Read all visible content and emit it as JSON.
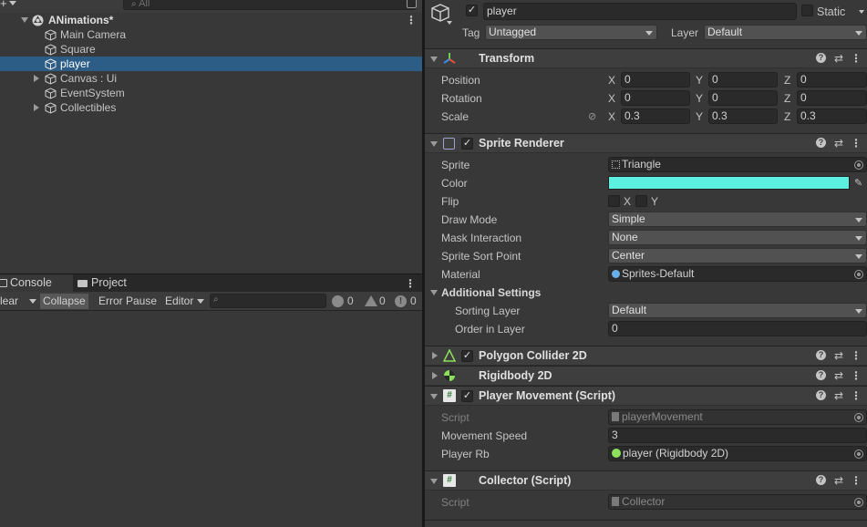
{
  "hierarchy": {
    "search_placeholder": "All",
    "scene_name": "ANimations*",
    "items": [
      {
        "label": "Main Camera",
        "expandable": false,
        "selected": false
      },
      {
        "label": "Square",
        "expandable": false,
        "selected": false
      },
      {
        "label": "player",
        "expandable": false,
        "selected": true
      },
      {
        "label": "Canvas : Ui",
        "expandable": true,
        "selected": false
      },
      {
        "label": "EventSystem",
        "expandable": false,
        "selected": false
      },
      {
        "label": "Collectibles",
        "expandable": true,
        "selected": false
      }
    ]
  },
  "console": {
    "tab_console": "Console",
    "tab_project": "Project",
    "clear_label": "lear",
    "collapse_label": "Collapse",
    "error_pause_label": "Error Pause",
    "editor_label": "Editor",
    "log_count": "0",
    "warn_count": "0",
    "error_count": "0"
  },
  "inspector": {
    "object_name": "player",
    "static_label": "Static",
    "tag_label": "Tag",
    "tag_value": "Untagged",
    "layer_label": "Layer",
    "layer_value": "Default",
    "transform": {
      "title": "Transform",
      "position_label": "Position",
      "rotation_label": "Rotation",
      "scale_label": "Scale",
      "position": {
        "x": "0",
        "y": "0",
        "z": "0"
      },
      "rotation": {
        "x": "0",
        "y": "0",
        "z": "0"
      },
      "scale": {
        "x": "0.3",
        "y": "0.3",
        "z": "0.3"
      },
      "axis_x": "X",
      "axis_y": "Y",
      "axis_z": "Z"
    },
    "sprite_renderer": {
      "title": "Sprite Renderer",
      "sprite_label": "Sprite",
      "sprite_value": "Triangle",
      "color_label": "Color",
      "color_value": "#5cf0e0",
      "flip_label": "Flip",
      "flip_x": "X",
      "flip_y": "Y",
      "draw_mode_label": "Draw Mode",
      "draw_mode_value": "Simple",
      "mask_label": "Mask Interaction",
      "mask_value": "None",
      "sort_point_label": "Sprite Sort Point",
      "sort_point_value": "Center",
      "material_label": "Material",
      "material_value": "Sprites-Default",
      "additional_label": "Additional Settings",
      "sorting_layer_label": "Sorting Layer",
      "sorting_layer_value": "Default",
      "order_label": "Order in Layer",
      "order_value": "0"
    },
    "polygon_collider": {
      "title": "Polygon Collider 2D"
    },
    "rigidbody": {
      "title": "Rigidbody 2D"
    },
    "player_movement": {
      "title": "Player Movement (Script)",
      "script_label": "Script",
      "script_value": "playerMovement",
      "speed_label": "Movement Speed",
      "speed_value": "3",
      "rb_label": "Player Rb",
      "rb_value": "player (Rigidbody 2D)"
    },
    "collector": {
      "title": "Collector (Script)",
      "script_label": "Script",
      "script_value": "Collector"
    }
  }
}
